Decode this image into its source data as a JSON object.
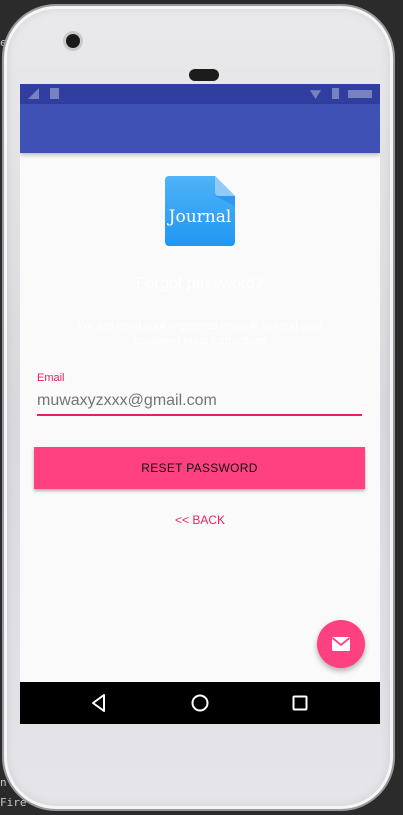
{
  "colors": {
    "primary_dark": "#303f9f",
    "primary": "#3f51b5",
    "accent": "#ff4081",
    "accent_text": "#e91e63",
    "screen_bg": "#fafafa"
  },
  "logo": {
    "text": "Journal",
    "icon": "journal-document-icon"
  },
  "page": {
    "title": "Forgot password?",
    "description": "We just need your registered email id to send your password reset instructions"
  },
  "form": {
    "email_label": "Email",
    "email_value": "muwaxyzxxx@gmail.com"
  },
  "actions": {
    "reset_label": "RESET PASSWORD",
    "back_label": "<< BACK",
    "fab_icon": "mail-icon"
  },
  "navbar": {
    "icons": [
      "back-triangle-icon",
      "home-circle-icon",
      "recents-square-icon"
    ]
  },
  "background": {
    "left_text_bottom_1": "n",
    "left_text_bottom_2": "Fire"
  }
}
